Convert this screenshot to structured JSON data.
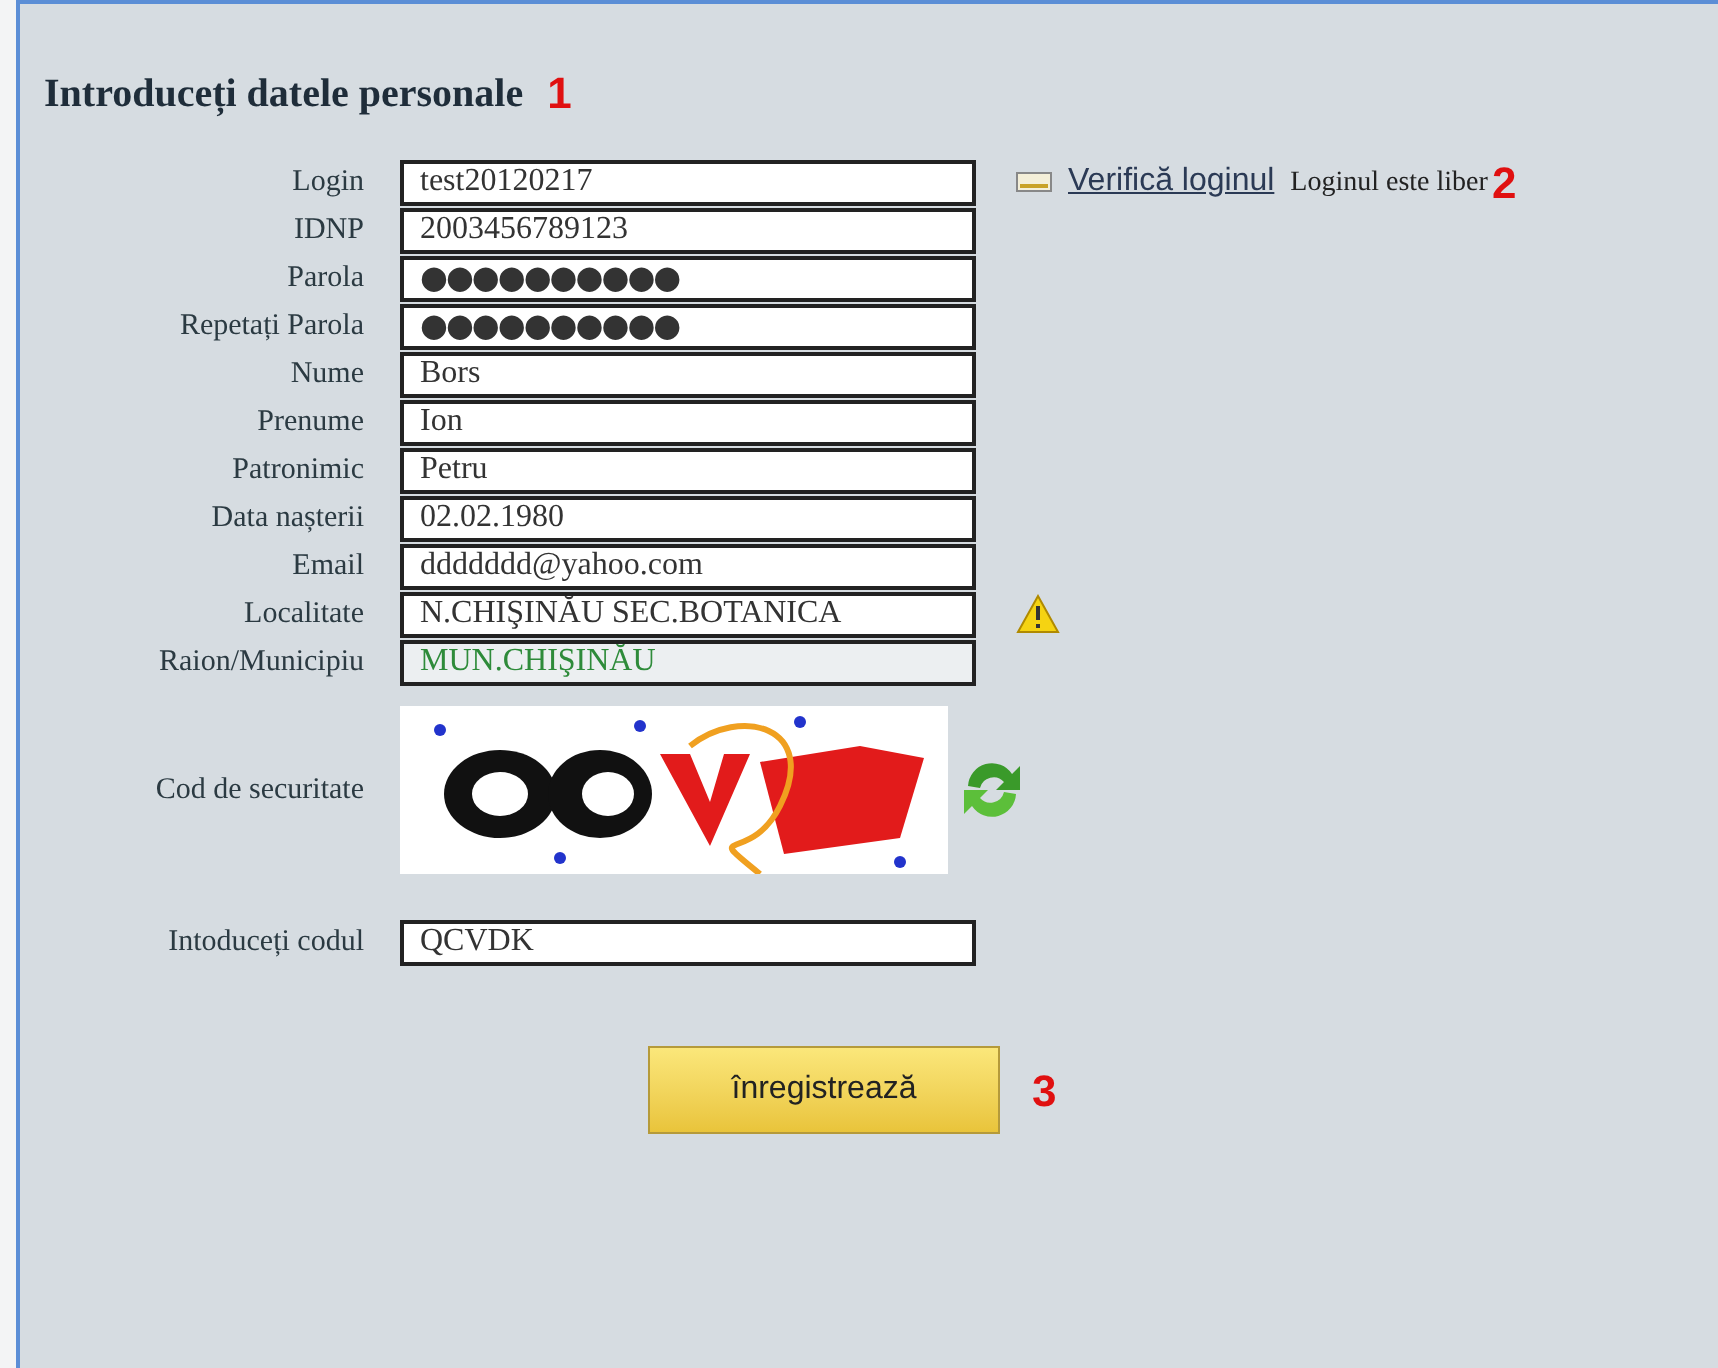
{
  "title": "Introduceți datele personale",
  "title_marker": "1",
  "fields": [
    {
      "label": "Login",
      "value": "test20120217",
      "kind": "text",
      "check_link": "Verifică loginul",
      "status": "Loginul este liber",
      "marker": "2"
    },
    {
      "label": "IDNP",
      "value": "2003456789123",
      "kind": "text"
    },
    {
      "label": "Parola",
      "value": "●●●●●●●●●●",
      "kind": "password"
    },
    {
      "label": "Repetați Parola",
      "value": "●●●●●●●●●●",
      "kind": "password"
    },
    {
      "label": "Nume",
      "value": "Bors",
      "kind": "text"
    },
    {
      "label": "Prenume",
      "value": "Ion",
      "kind": "text"
    },
    {
      "label": "Patronimic",
      "value": "Petru",
      "kind": "text"
    },
    {
      "label": "Data nașterii",
      "value": "02.02.1980",
      "kind": "text"
    },
    {
      "label": "Email",
      "value": "ddddddd@yahoo.com",
      "kind": "text"
    },
    {
      "label": "Localitate",
      "value": "N.CHIŞINĂU SEC.BOTANICA",
      "kind": "text",
      "warning": true
    },
    {
      "label": "Raion/Municipiu",
      "value": "MUN.CHIŞINĂU",
      "kind": "readonly"
    }
  ],
  "captcha": {
    "label": "Cod de securitate"
  },
  "code": {
    "label": "Intoduceți codul",
    "value": "QCVDK"
  },
  "submit": {
    "label": "înregistrează",
    "marker": "3"
  }
}
